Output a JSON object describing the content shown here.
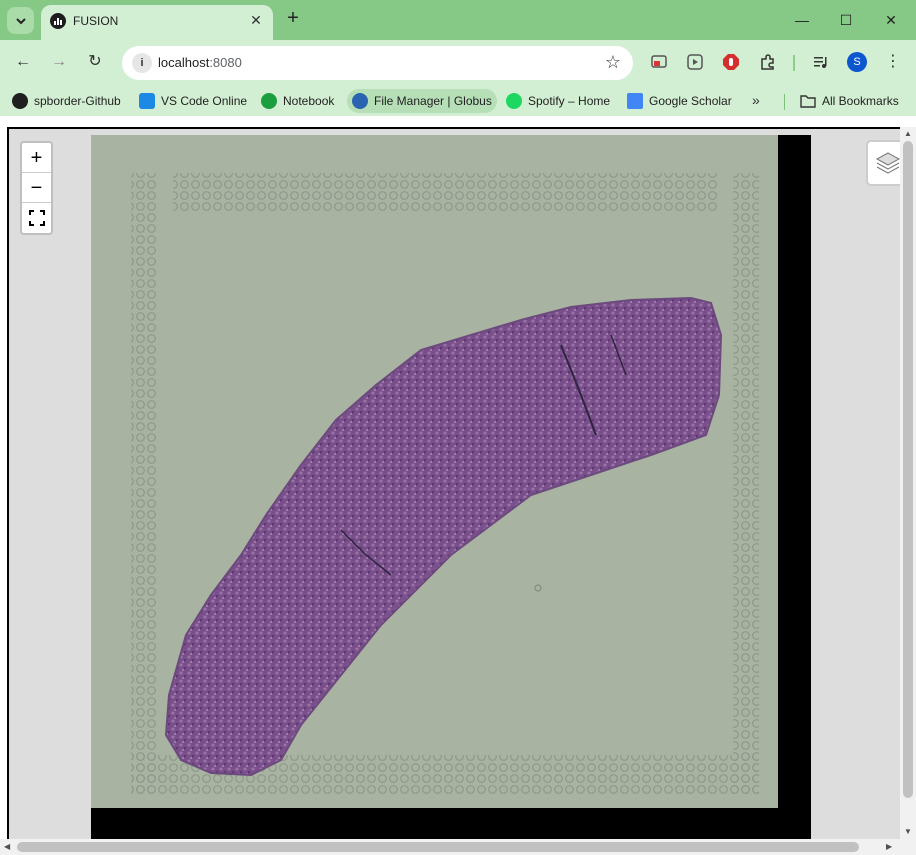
{
  "browser": {
    "active_tab": {
      "title": "FUSION"
    },
    "address": {
      "host": "localhost",
      "port": ":8080"
    },
    "profile_initial": "S"
  },
  "bookmarks": [
    {
      "label": "spborder-Github",
      "icon": "github-icon",
      "color": "#1f1f1f"
    },
    {
      "label": "VS Code Online",
      "icon": "vscode-icon",
      "color": "#1e88e5"
    },
    {
      "label": "Notebook",
      "icon": "evernote-icon",
      "color": "#1b9e3e"
    },
    {
      "label": "File Manager | Globus",
      "icon": "globus-icon",
      "color": "#2a63b0"
    },
    {
      "label": "Spotify – Home",
      "icon": "spotify-icon",
      "color": "#1ed760"
    },
    {
      "label": "Google Scholar",
      "icon": "scholar-icon",
      "color": "#4285f4"
    }
  ],
  "all_bookmarks": "All Bookmarks",
  "map": {
    "zoom_in": "+",
    "zoom_out": "−"
  }
}
